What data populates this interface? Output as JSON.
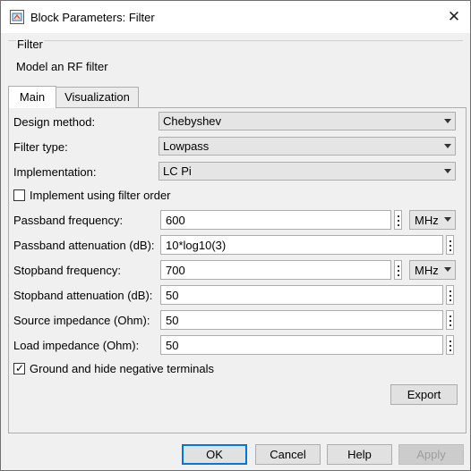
{
  "window": {
    "title": "Block Parameters: Filter",
    "icon": "simulink-block-icon"
  },
  "group": {
    "title": "Filter",
    "description": "Model an RF filter"
  },
  "tabs": [
    {
      "label": "Main",
      "active": true
    },
    {
      "label": "Visualization",
      "active": false
    }
  ],
  "params": {
    "design_method": {
      "label": "Design method:",
      "value": "Chebyshev"
    },
    "filter_type": {
      "label": "Filter type:",
      "value": "Lowpass"
    },
    "implementation": {
      "label": "Implementation:",
      "value": "LC Pi"
    },
    "use_filter_order": {
      "label": "Implement using filter order",
      "checked": false
    },
    "passband_freq": {
      "label": "Passband frequency:",
      "value": "600",
      "unit": "MHz"
    },
    "passband_atten": {
      "label": "Passband attenuation (dB):",
      "value": "10*log10(3)"
    },
    "stopband_freq": {
      "label": "Stopband frequency:",
      "value": "700",
      "unit": "MHz"
    },
    "stopband_atten": {
      "label": "Stopband attenuation (dB):",
      "value": "50"
    },
    "source_imp": {
      "label": "Source impedance (Ohm):",
      "value": "50"
    },
    "load_imp": {
      "label": "Load impedance (Ohm):",
      "value": "50"
    },
    "ground_hide": {
      "label": "Ground and hide negative terminals",
      "checked": true
    }
  },
  "buttons": {
    "export": "Export",
    "ok": "OK",
    "cancel": "Cancel",
    "help": "Help",
    "apply": "Apply"
  },
  "colors": {
    "accent": "#0078d7",
    "disabled_text": "#9d9d9d"
  }
}
